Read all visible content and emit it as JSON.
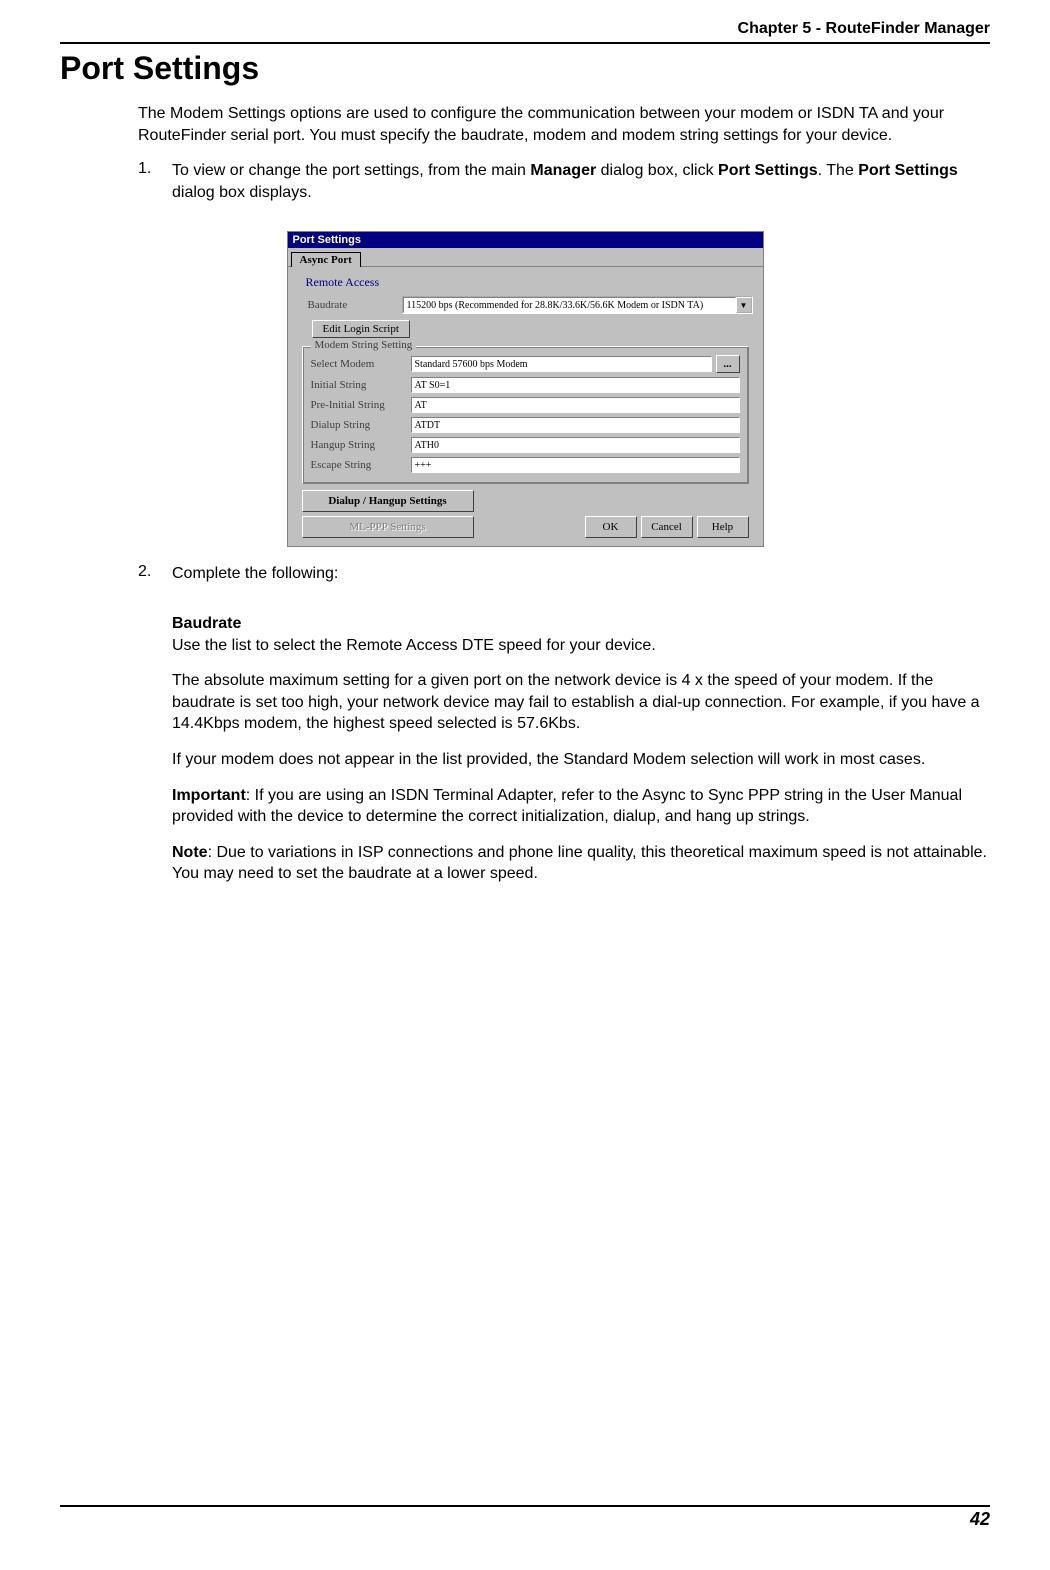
{
  "header": {
    "chapter": "Chapter 5 - RouteFinder Manager"
  },
  "title": "Port Settings",
  "intro": "The Modem Settings options are used to configure the communication between your modem or ISDN TA and your RouteFinder serial port.  You must specify the baudrate, modem and modem string settings for your device.",
  "steps": {
    "s1_num": "1.",
    "s1a": "To view or change the port settings, from the main ",
    "s1b_bold": "Manager",
    "s1c": " dialog box, click ",
    "s1d_bold": "Port Settings",
    "s1e": ".  The ",
    "s1f_bold": "Port Settings",
    "s1g": " dialog box displays.",
    "s2_num": "2.",
    "s2_text": "Complete the following:"
  },
  "details": {
    "h_baudrate": "Baudrate",
    "p_baudrate1": "Use the list to select the Remote Access DTE speed for your device.",
    "p_baudrate2": "The absolute maximum setting for a given port on the network device is 4 x the speed of your modem.  If the baudrate is set too high, your network device may fail to establish a dial-up connection.  For example, if you have a 14.4Kbps modem, the highest speed selected is 57.6Kbs.",
    "p_baudrate3": "If your modem does not appear in the list provided, the Standard Modem selection will work in most cases.",
    "imp_label": "Important",
    "imp_text": ":  If you are using an ISDN Terminal Adapter, refer to the Async to Sync PPP string in the User Manual provided with the device to determine the correct initialization, dialup, and hang up strings.",
    "note_label": "Note",
    "note_text": ":  Due to variations in ISP connections and phone line quality, this theoretical maximum speed is not attainable.  You may need to set the baudrate at a lower speed."
  },
  "dialog": {
    "title": "Port Settings",
    "tab": "Async Port",
    "remote_access": "Remote Access",
    "baudrate_label": "Baudrate",
    "baudrate_value": "115200 bps (Recommended for 28.8K/33.6K/56.6K Modem or ISDN TA)",
    "edit_login": "Edit Login Script",
    "group_title": "Modem String Setting",
    "rows": {
      "select_modem_label": "Select Modem",
      "select_modem_value": "Standard 57600 bps Modem",
      "ellipsis": "...",
      "initial_label": "Initial String",
      "initial_value": "AT S0=1",
      "preinitial_label": "Pre-Initial String",
      "preinitial_value": "AT",
      "dialup_label": "Dialup String",
      "dialup_value": "ATDT",
      "hangup_label": "Hangup String",
      "hangup_value": "ATH0",
      "escape_label": "Escape String",
      "escape_value": "+++"
    },
    "btn_dialup_hangup": "Dialup / Hangup Settings",
    "btn_mlppp": "ML-PPP Settings",
    "btn_ok": "OK",
    "btn_cancel": "Cancel",
    "btn_help": "Help"
  },
  "page_number": "42"
}
